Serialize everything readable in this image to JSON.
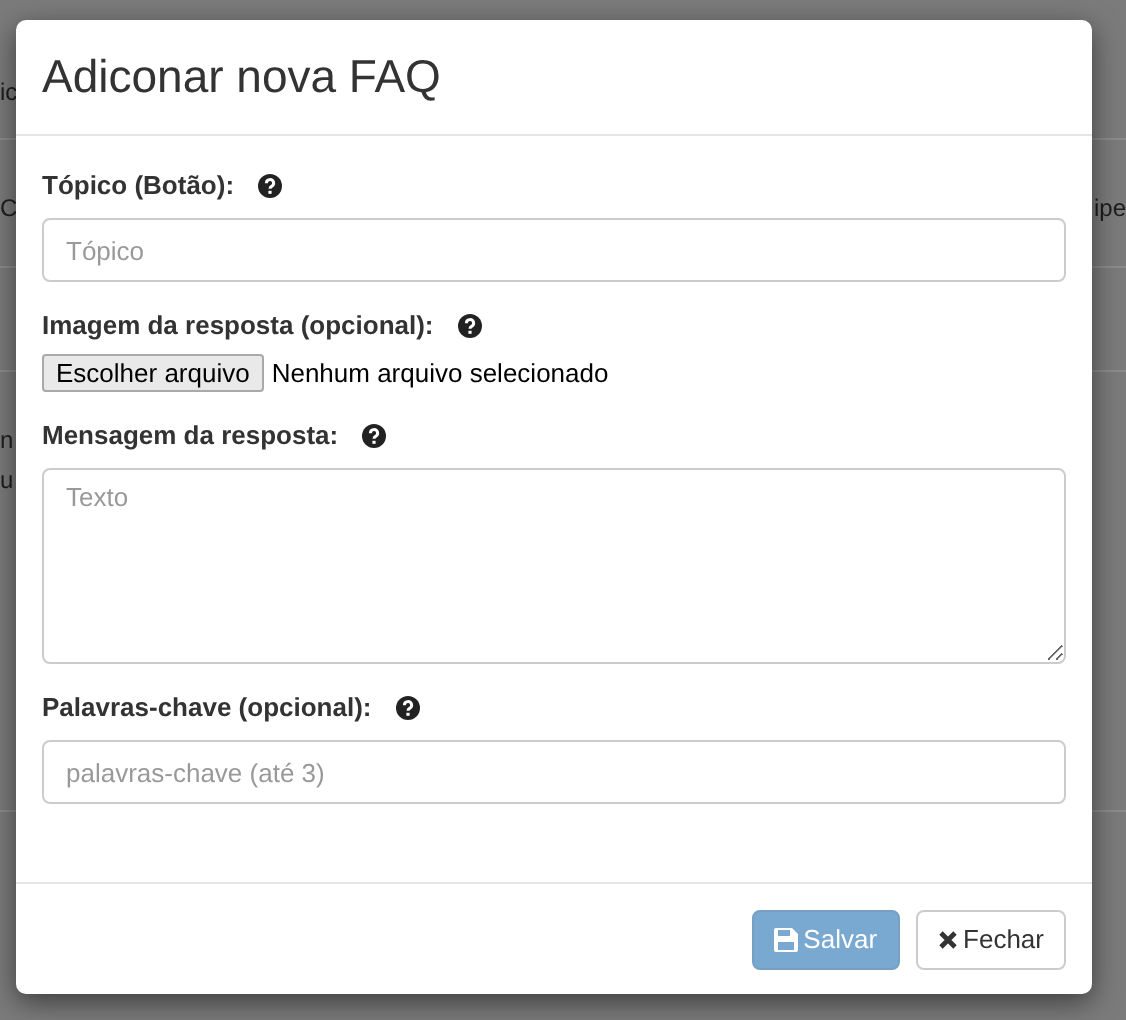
{
  "backdrop": {
    "rows": [
      {
        "left": [
          "ic"
        ],
        "right": []
      },
      {
        "left": [
          "C"
        ],
        "right": [
          "ipe"
        ]
      },
      {
        "left": [],
        "right": []
      },
      {
        "left": [
          "n",
          "u"
        ],
        "right": []
      }
    ]
  },
  "modal": {
    "title": "Adiconar nova FAQ",
    "fields": [
      {
        "kind": "text",
        "label": "Tópico (Botão):",
        "placeholder": "Tópico"
      },
      {
        "kind": "file",
        "label": "Imagem da resposta (opcional):",
        "button": "Escolher arquivo",
        "status": "Nenhum arquivo selecionado"
      },
      {
        "kind": "textarea",
        "label": "Mensagem da resposta:",
        "placeholder": "Texto"
      },
      {
        "kind": "text",
        "label": "Palavras-chave (opcional):",
        "placeholder": "palavras-chave (até 3)"
      }
    ],
    "buttons": [
      {
        "kind": "save",
        "label": "Salvar",
        "disabled": true
      },
      {
        "kind": "close",
        "label": "Fechar",
        "disabled": false
      }
    ]
  }
}
